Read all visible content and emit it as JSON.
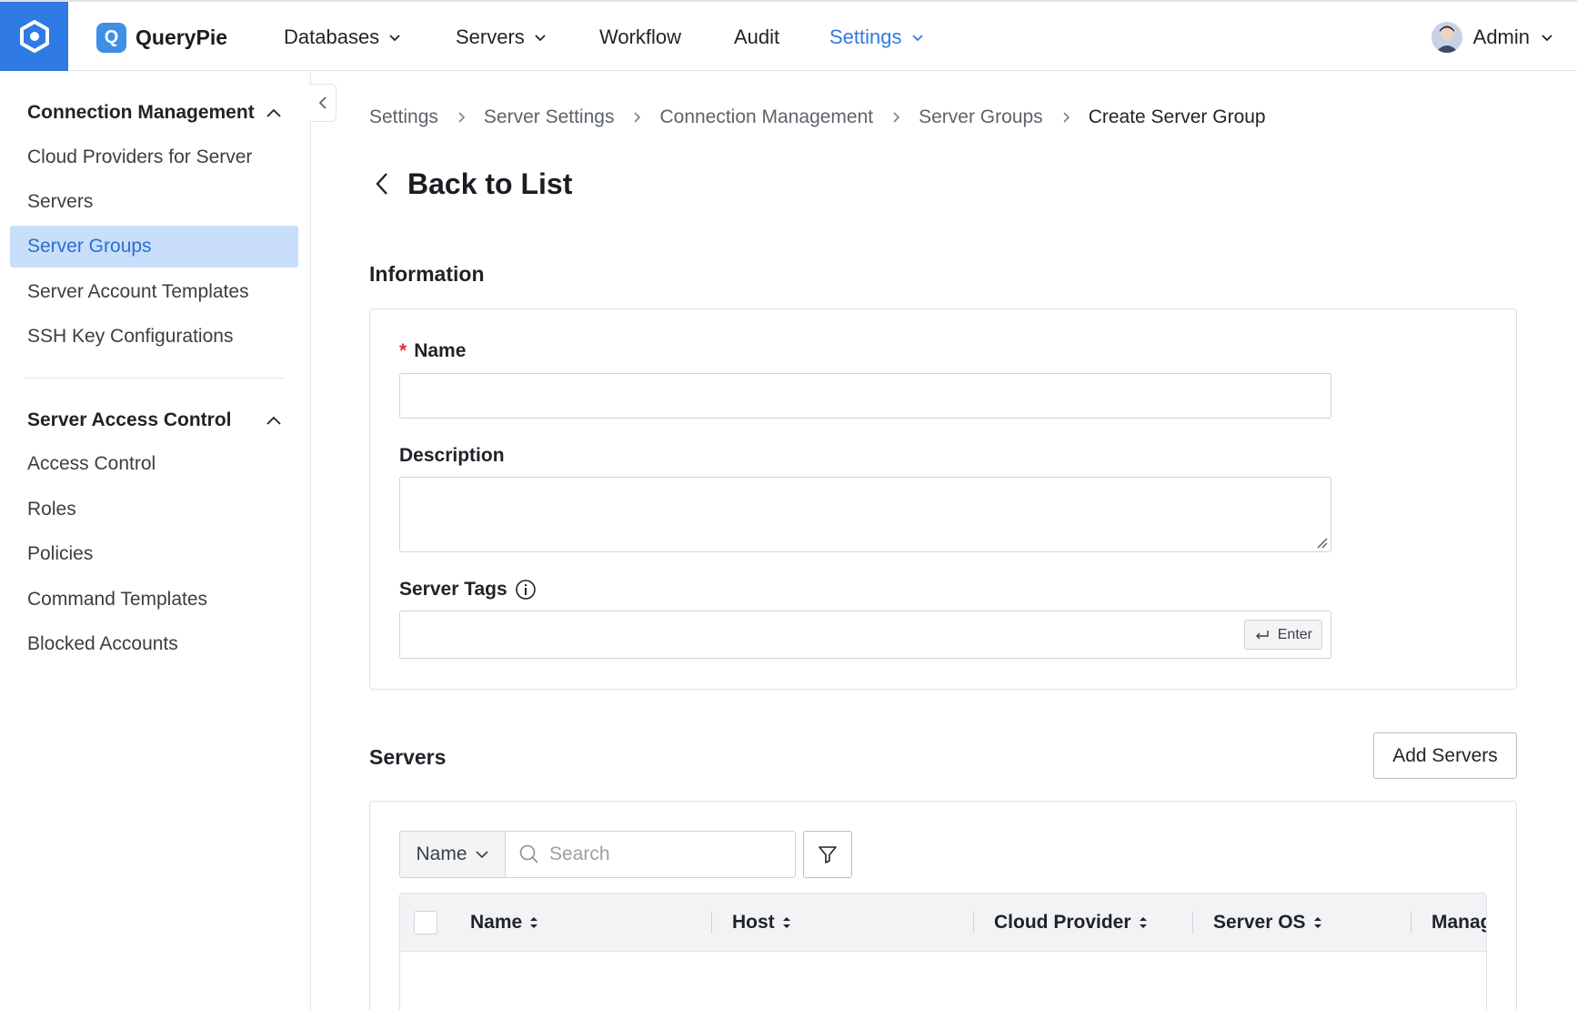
{
  "nav": {
    "brand": "QueryPie",
    "brand_badge": "Q",
    "items": [
      {
        "label": "Databases",
        "dropdown": true
      },
      {
        "label": "Servers",
        "dropdown": true
      },
      {
        "label": "Workflow",
        "dropdown": false
      },
      {
        "label": "Audit",
        "dropdown": false
      },
      {
        "label": "Settings",
        "dropdown": true,
        "active": true
      }
    ],
    "user": "Admin",
    "accent_color": "#2f7ae5"
  },
  "sidebar": {
    "sections": [
      {
        "title": "Connection Management",
        "expanded": true,
        "items": [
          {
            "label": "Cloud Providers for Server"
          },
          {
            "label": "Servers"
          },
          {
            "label": "Server Groups",
            "active": true
          },
          {
            "label": "Server Account Templates"
          },
          {
            "label": "SSH Key Configurations"
          }
        ]
      },
      {
        "title": "Server Access Control",
        "expanded": true,
        "items": [
          {
            "label": "Access Control"
          },
          {
            "label": "Roles"
          },
          {
            "label": "Policies"
          },
          {
            "label": "Command Templates"
          },
          {
            "label": "Blocked Accounts"
          }
        ]
      }
    ]
  },
  "breadcrumb": [
    "Settings",
    "Server Settings",
    "Connection Management",
    "Server Groups",
    "Create Server Group"
  ],
  "page": {
    "back_label": "Back to List",
    "information_title": "Information",
    "name_label": "Name",
    "name_value": "",
    "description_label": "Description",
    "description_value": "",
    "server_tags_label": "Server Tags",
    "server_tags_value": "",
    "enter_label": "Enter",
    "servers_title": "Servers",
    "add_servers_label": "Add Servers",
    "search_field_option": "Name",
    "search_placeholder": "Search",
    "table_columns": [
      "Name",
      "Host",
      "Cloud Provider",
      "Server OS",
      "Manag"
    ]
  }
}
